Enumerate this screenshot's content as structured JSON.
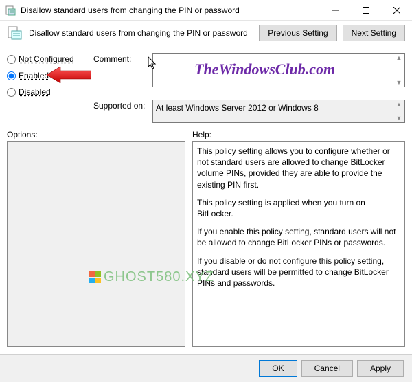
{
  "window": {
    "title": "Disallow standard users from changing the PIN or password"
  },
  "header": {
    "policy_title": "Disallow standard users from changing the PIN or password",
    "prev_btn": "Previous Setting",
    "next_btn": "Next Setting"
  },
  "radios": {
    "not_configured": "Not Configured",
    "enabled": "Enabled",
    "disabled": "Disabled",
    "selected": "enabled"
  },
  "labels": {
    "comment": "Comment:",
    "supported_on": "Supported on:",
    "options": "Options:",
    "help": "Help:"
  },
  "fields": {
    "comment_value": "",
    "supported_value": "At least Windows Server 2012 or Windows 8"
  },
  "help": {
    "p1": "This policy setting allows you to configure whether or not standard users are allowed to change BitLocker volume PINs, provided they are able to provide the existing PIN first.",
    "p2": "This policy setting is applied when you turn on BitLocker.",
    "p3": "If you enable this policy setting, standard users will not be allowed to change BitLocker PINs or passwords.",
    "p4": "If you disable or do not configure this policy setting, standard users will be permitted to change BitLocker PINs and passwords."
  },
  "footer": {
    "ok": "OK",
    "cancel": "Cancel",
    "apply": "Apply"
  },
  "watermarks": {
    "wm1": "TheWindowsClub.com",
    "wm2": "GHOST580.XYZ"
  }
}
